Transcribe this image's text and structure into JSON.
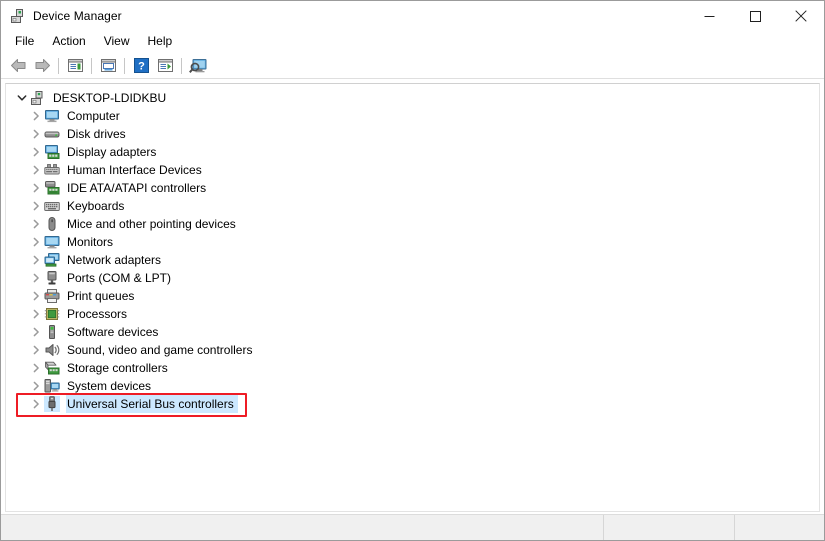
{
  "window": {
    "title": "Device Manager",
    "icon": "device-manager-icon",
    "caption_buttons": [
      {
        "name": "minimize-button",
        "glyph": "minimize"
      },
      {
        "name": "maximize-button",
        "glyph": "maximize"
      },
      {
        "name": "close-button",
        "glyph": "close"
      }
    ]
  },
  "menubar": {
    "items": [
      {
        "label": "File"
      },
      {
        "label": "Action"
      },
      {
        "label": "View"
      },
      {
        "label": "Help"
      }
    ]
  },
  "toolbar": {
    "buttons": [
      {
        "name": "back-button",
        "icon": "back-arrow-icon"
      },
      {
        "name": "forward-button",
        "icon": "forward-arrow-icon"
      },
      {
        "name": "separator-1",
        "icon": "separator"
      },
      {
        "name": "show-hidden-devices-button",
        "icon": "list-view-icon"
      },
      {
        "name": "separator-2",
        "icon": "separator"
      },
      {
        "name": "properties-button",
        "icon": "properties-icon"
      },
      {
        "name": "separator-3",
        "icon": "separator"
      },
      {
        "name": "help-button",
        "icon": "question-mark-icon"
      },
      {
        "name": "update-driver-button",
        "icon": "update-driver-icon"
      },
      {
        "name": "separator-4",
        "icon": "separator"
      },
      {
        "name": "scan-hardware-changes-button",
        "icon": "scan-monitor-icon"
      }
    ]
  },
  "tree": {
    "root": {
      "label": "DESKTOP-LDIDKBU",
      "icon": "computer-root-icon",
      "expanded": true,
      "chevron": "chevron-down"
    },
    "nodes": [
      {
        "label": "Computer",
        "icon": "computer-icon"
      },
      {
        "label": "Disk drives",
        "icon": "disk-drive-icon"
      },
      {
        "label": "Display adapters",
        "icon": "display-adapter-icon"
      },
      {
        "label": "Human Interface Devices",
        "icon": "hid-icon"
      },
      {
        "label": "IDE ATA/ATAPI controllers",
        "icon": "ide-controller-icon"
      },
      {
        "label": "Keyboards",
        "icon": "keyboard-icon"
      },
      {
        "label": "Mice and other pointing devices",
        "icon": "mouse-icon"
      },
      {
        "label": "Monitors",
        "icon": "monitor-icon"
      },
      {
        "label": "Network adapters",
        "icon": "network-adapter-icon"
      },
      {
        "label": "Ports (COM & LPT)",
        "icon": "port-icon"
      },
      {
        "label": "Print queues",
        "icon": "printer-icon"
      },
      {
        "label": "Processors",
        "icon": "processor-icon"
      },
      {
        "label": "Software devices",
        "icon": "software-device-icon"
      },
      {
        "label": "Sound, video and game controllers",
        "icon": "speaker-icon"
      },
      {
        "label": "Storage controllers",
        "icon": "storage-controller-icon"
      },
      {
        "label": "System devices",
        "icon": "system-device-icon"
      },
      {
        "label": "Universal Serial Bus controllers",
        "icon": "usb-icon",
        "selected": true,
        "annotated": true
      }
    ]
  },
  "statusbar": {
    "panes": [
      {
        "name": "status-pane-main",
        "text": ""
      },
      {
        "name": "status-pane-second",
        "text": ""
      },
      {
        "name": "status-pane-third",
        "text": ""
      }
    ]
  },
  "colors": {
    "selection": "#cce8ff",
    "annotation": "#ee1c25",
    "window_border": "#9b9b9b",
    "statusbar_bg": "#f0f0f0"
  }
}
